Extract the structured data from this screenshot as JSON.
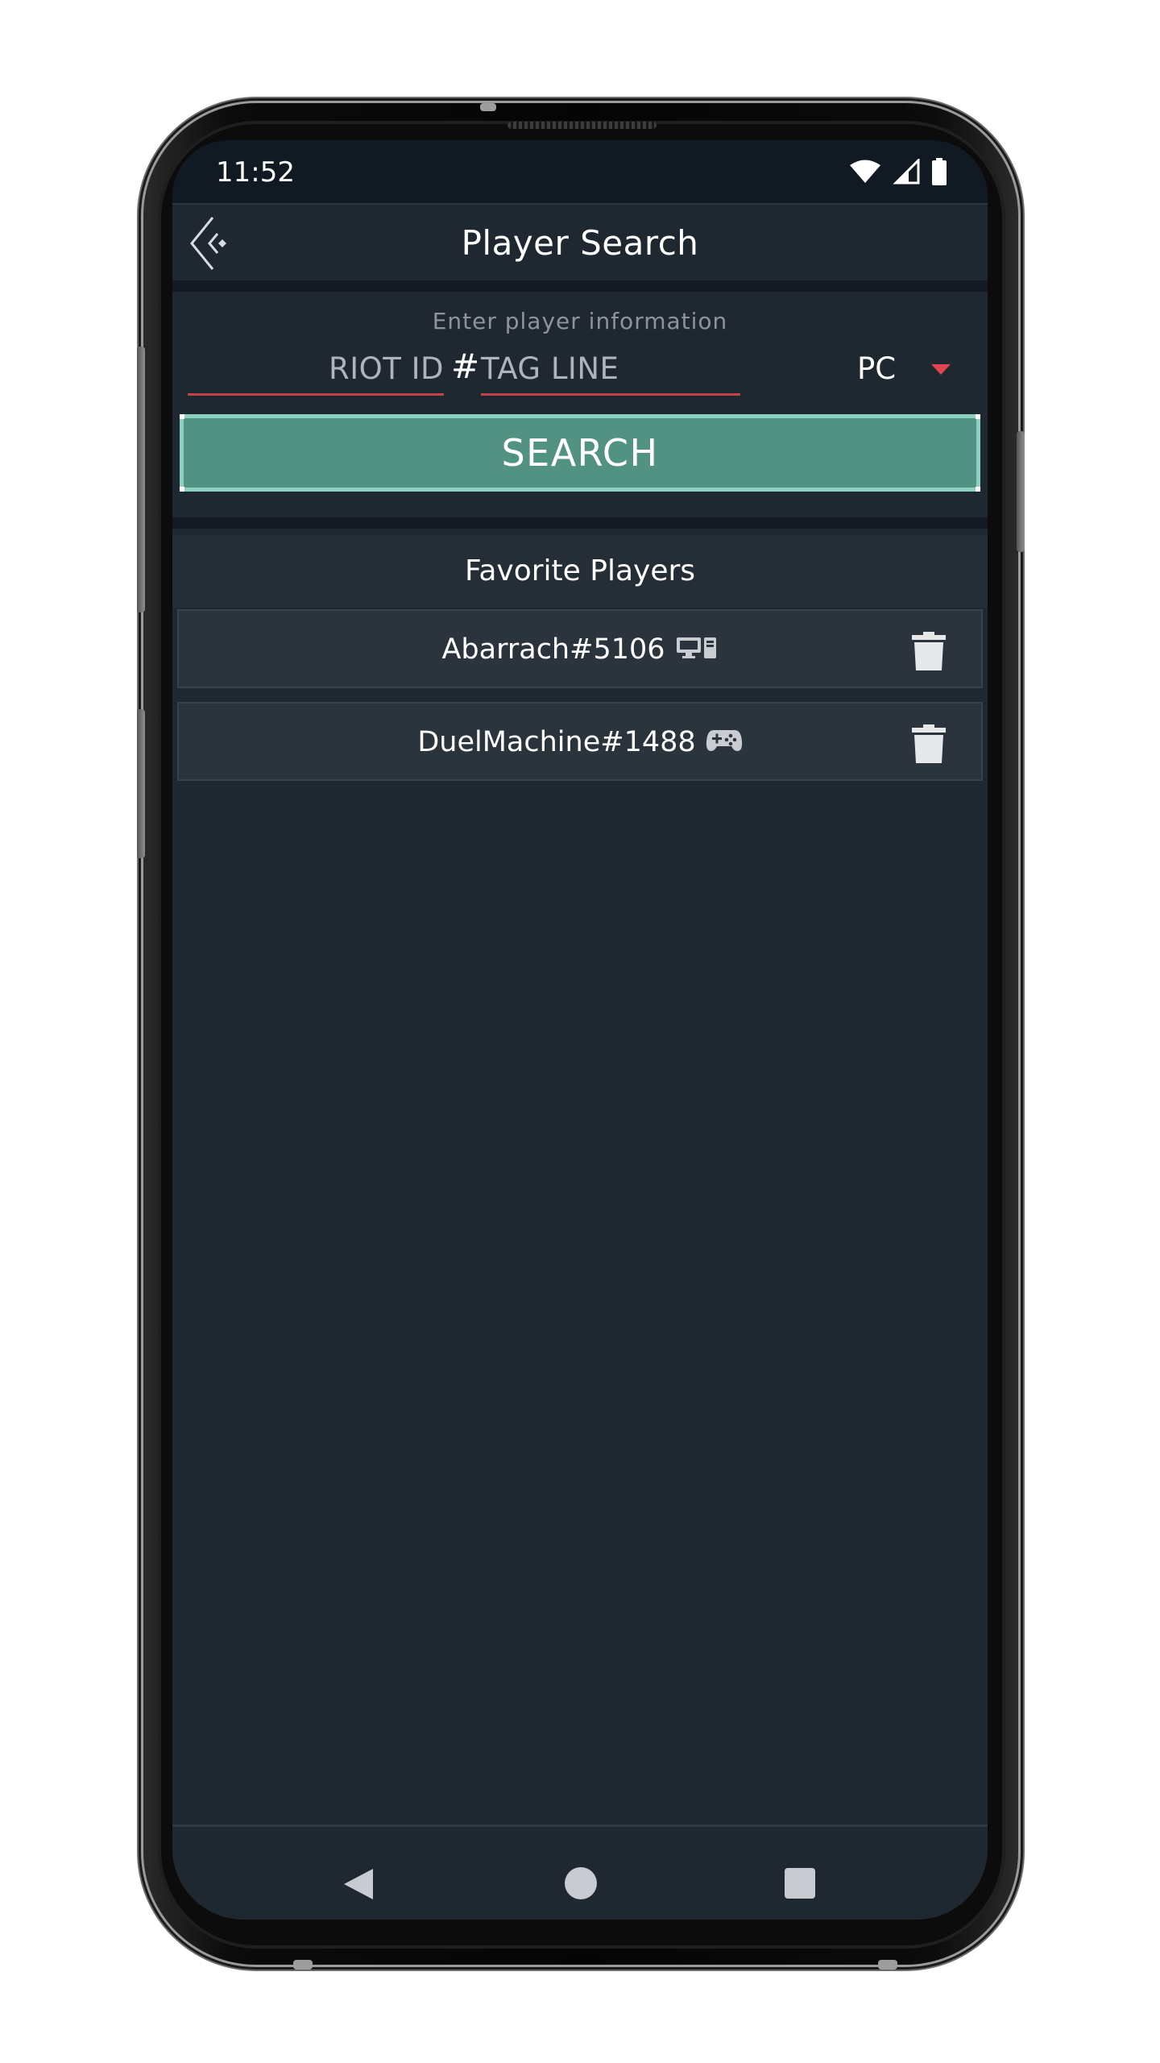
{
  "status_bar": {
    "time": "11:52",
    "icons": [
      "wifi-icon",
      "signal-icon",
      "battery-icon"
    ]
  },
  "app_bar": {
    "title": "Player Search",
    "back_icon": "back-arrow-icon"
  },
  "search_form": {
    "hint": "Enter player information",
    "riot_id_placeholder": "RIOT ID",
    "separator": "#",
    "tag_line_placeholder": "TAG LINE",
    "platform_selected": "PC",
    "search_button_label": "SEARCH"
  },
  "favorites": {
    "title": "Favorite Players",
    "players": [
      {
        "name": "Abarrach#5106",
        "platform_icon": "pc-icon",
        "delete_icon": "trash-icon"
      },
      {
        "name": "DuelMachine#1488",
        "platform_icon": "gamepad-icon",
        "delete_icon": "trash-icon"
      }
    ]
  },
  "colors": {
    "background": "#1f2731",
    "status_bar": "#111922",
    "accent_green": "#529283",
    "accent_red": "#e04352",
    "row_background": "#2b333d"
  }
}
